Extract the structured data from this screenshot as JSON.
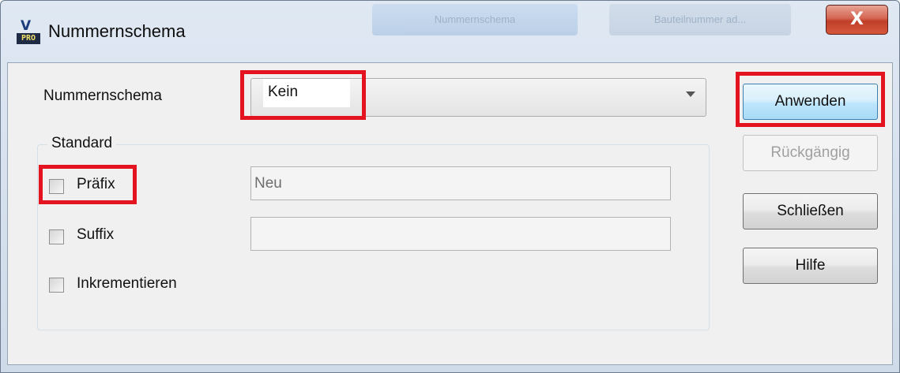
{
  "window": {
    "title": "Nummernschema",
    "icon_top": "V",
    "icon_bottom": "PRO",
    "close_glyph": "X",
    "background_tabs": [
      "Nummernschema",
      "Bauteilnummer ad..."
    ]
  },
  "form": {
    "schema_label": "Nummernschema",
    "schema_value": "Kein",
    "group_title": "Standard",
    "prefix": {
      "label": "Präfix",
      "checked": false,
      "value": "Neu"
    },
    "suffix": {
      "label": "Suffix",
      "checked": false,
      "value": ""
    },
    "increment": {
      "label": "Inkrementieren",
      "checked": false
    }
  },
  "buttons": {
    "apply": "Anwenden",
    "undo": "Rückgängig",
    "close": "Schließen",
    "help": "Hilfe"
  },
  "colors": {
    "highlight": "#e3141f",
    "close_button": "#c03e28",
    "apply_border": "#3c7fb1"
  }
}
